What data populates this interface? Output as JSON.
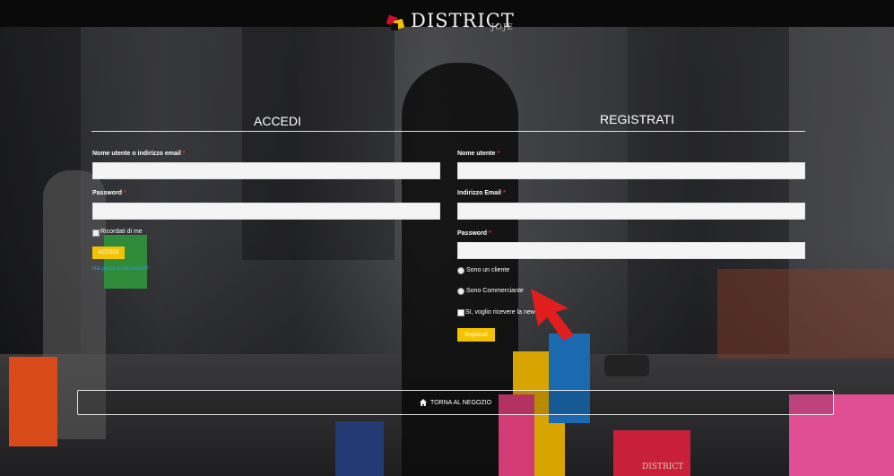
{
  "brand": {
    "logo_text": "DISTRICT",
    "logo_sub": "JOJE",
    "watermark": "DISTRICT"
  },
  "login": {
    "title": "ACCEDI",
    "username_label": "Nome utente o indirizzo email",
    "username_value": "",
    "password_label": "Password",
    "password_value": "",
    "remember_label": "Ricordati di me",
    "submit_label": "ACCEDI",
    "lost_password_link": "Hai perso la password?"
  },
  "register": {
    "title": "REGISTRATI",
    "username_label": "Nome utente",
    "username_value": "",
    "email_label": "Indirizzo Email",
    "email_value": "",
    "password_label": "Password",
    "password_value": "",
    "option_cliente": "Sono un cliente",
    "option_commerciante": "Sono Commerciante",
    "newsletter_label": "SI, voglio ricevere la new",
    "submit_label": "Registrati"
  },
  "back_to_shop": "TORNA AL NEGOZIO",
  "colors": {
    "accent": "#f4c300",
    "required": "#e03030",
    "link": "#2d9cdb",
    "arrow": "#e01e1e"
  }
}
